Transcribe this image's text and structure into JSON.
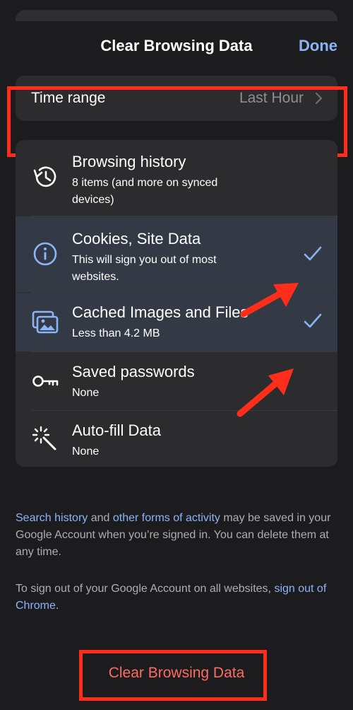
{
  "header": {
    "title": "Clear Browsing Data",
    "done_label": "Done"
  },
  "time_range": {
    "label": "Time range",
    "value": "Last Hour"
  },
  "items": [
    {
      "title": "Browsing history",
      "subtitle": "8 items (and more on synced devices)",
      "icon": "history-icon",
      "checked": false
    },
    {
      "title": "Cookies, Site Data",
      "subtitle": "This will sign you out of most websites.",
      "icon": "info-icon",
      "checked": true
    },
    {
      "title": "Cached Images and Files",
      "subtitle": "Less than 4.2 MB",
      "icon": "images-icon",
      "checked": true
    },
    {
      "title": "Saved passwords",
      "subtitle": "None",
      "icon": "key-icon",
      "checked": false
    },
    {
      "title": "Auto-fill Data",
      "subtitle": "None",
      "icon": "magic-wand-icon",
      "checked": false
    }
  ],
  "footer": {
    "p1_link1": "Search history",
    "p1_text1": " and ",
    "p1_link2": "other forms of activity",
    "p1_text2": " may be saved in your Google Account when you’re signed in. You can delete them at any time.",
    "p2_text": "To sign out of your Google Account on all websites, ",
    "p2_link": "sign out of Chrome",
    "p2_end": "."
  },
  "clear_label": "Clear Browsing Data",
  "colors": {
    "accent": "#8ab4f8",
    "annotation": "#ff2d1a",
    "destructive": "#ff6b60"
  }
}
